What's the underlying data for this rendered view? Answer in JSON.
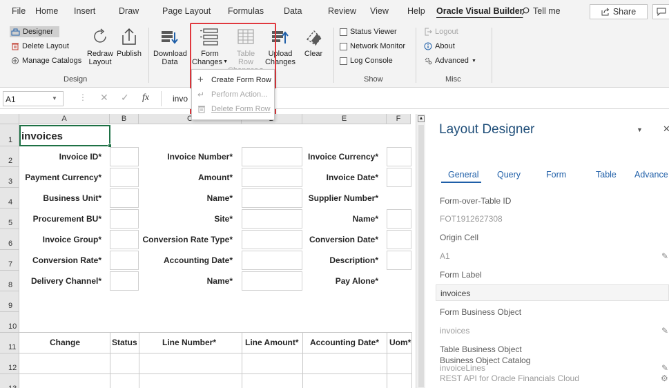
{
  "menubar": {
    "items": [
      "File",
      "Home",
      "Insert",
      "Draw",
      "Page Layout",
      "Formulas",
      "Data",
      "Review",
      "View",
      "Help",
      "Oracle Visual Builder"
    ],
    "tell_me": "Tell me",
    "share": "Share"
  },
  "ribbon": {
    "designer": "Designer",
    "delete_layout": "Delete Layout",
    "manage_catalogs": "Manage Catalogs",
    "redraw": "Redraw",
    "redraw2": "Layout",
    "publish": "Publish",
    "download": "Download",
    "download2": "Data",
    "form_changes": "Form",
    "form_changes2": "Changes",
    "table_row": "Table Row",
    "table_row2": "Changes",
    "upload": "Upload",
    "upload2": "Changes",
    "clear": "Clear",
    "status_viewer": "Status Viewer",
    "network_monitor": "Network Monitor",
    "log_console": "Log Console",
    "logout": "Logout",
    "about": "About",
    "advanced": "Advanced",
    "group_design": "Design",
    "group_show": "Show",
    "group_misc": "Misc"
  },
  "dropdown": {
    "create": "Create Form Row",
    "perform": "Perform Action...",
    "delete": "Delete Form Row"
  },
  "formula_bar": {
    "cell_ref": "A1",
    "fx": "fx",
    "value": "invo"
  },
  "grid": {
    "columns": [
      "A",
      "B",
      "C",
      "D",
      "E",
      "F"
    ],
    "rows": [
      "1",
      "2",
      "3",
      "4",
      "5",
      "6",
      "7",
      "8",
      "9",
      "10",
      "11",
      "12",
      "13"
    ],
    "title": "invoices",
    "labels_a": [
      "Invoice ID*",
      "Payment Currency*",
      "Business Unit*",
      "Procurement BU*",
      "Invoice Group*",
      "Conversion Rate*",
      "Delivery Channel*"
    ],
    "labels_c": [
      "Invoice Number*",
      "Amount*",
      "Name*",
      "Site*",
      "Conversion Rate Type*",
      "Accounting Date*",
      "Name*"
    ],
    "labels_e": [
      "Invoice Currency*",
      "Invoice Date*",
      "Supplier Number*",
      "Name*",
      "Conversion Date*",
      "Description*",
      "Pay Alone*"
    ],
    "table_headers": [
      "Change",
      "Status",
      "Line Number*",
      "Line Amount*",
      "Accounting Date*",
      "Uom*"
    ]
  },
  "panel": {
    "title": "Layout Designer",
    "tabs": [
      "General",
      "Query",
      "Form",
      "Table",
      "Advance"
    ],
    "fields": [
      {
        "label": "Form-over-Table ID",
        "value": "FOT1912627308"
      },
      {
        "label": "Origin Cell",
        "value": "A1"
      },
      {
        "label": "Form Label",
        "value": "invoices"
      },
      {
        "label": "Form Business Object",
        "value": "invoices"
      },
      {
        "label": "Table Business Object",
        "value": "invoiceLines"
      },
      {
        "label": "Business Object Catalog",
        "value": "REST API for Oracle Financials Cloud"
      }
    ]
  },
  "colors": {
    "accent": "#1f5fa8",
    "highlight_red": "#e0383e",
    "selected_cell": "#1e7145"
  }
}
